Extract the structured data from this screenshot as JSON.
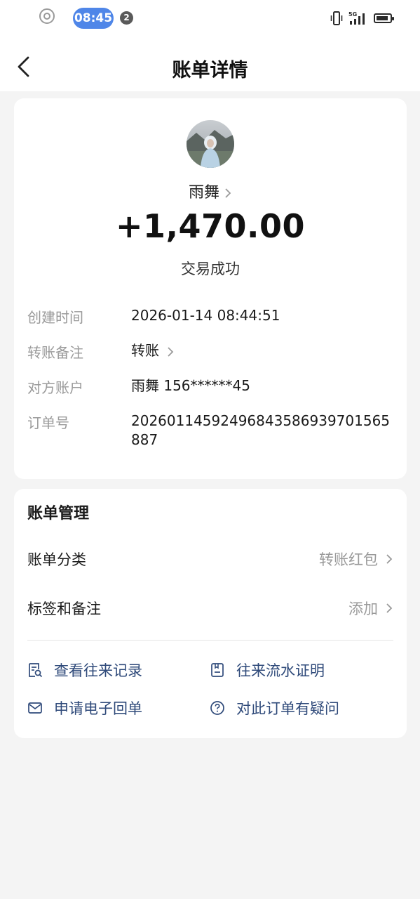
{
  "status_bar": {
    "time": "08:45",
    "notification_count": "2",
    "signal_label": "5G"
  },
  "header": {
    "title": "账单详情"
  },
  "transaction": {
    "counterparty_name": "雨舞",
    "amount": "+1,470.00",
    "status": "交易成功"
  },
  "details": [
    {
      "label": "创建时间",
      "value": "2026-01-14 08:44:51"
    },
    {
      "label": "转账备注",
      "value": "转账"
    },
    {
      "label": "对方账户",
      "value": "雨舞 156******45"
    },
    {
      "label": "订单号",
      "value": "2026011459249684358693970156588​7"
    }
  ],
  "management": {
    "title": "账单管理",
    "category_label": "账单分类",
    "category_value": "转账红包",
    "tags_label": "标签和备注",
    "tags_value": "添加"
  },
  "actions": {
    "view_records": "查看往来记录",
    "flow_certificate": "往来流水证明",
    "e_receipt": "申请电子回单",
    "question": "对此订单有疑问"
  },
  "colors": {
    "accent": "#4f86e8",
    "action_text": "#2f4a7a",
    "muted": "#9a9a9a",
    "background": "#f4f4f4"
  }
}
